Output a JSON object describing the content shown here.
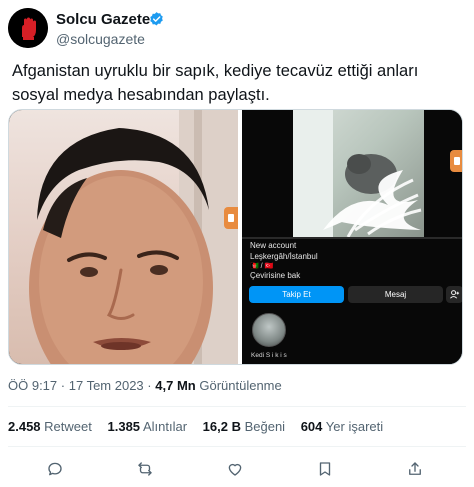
{
  "author": {
    "display_name": "Solcu Gazete",
    "handle": "@solcugazete",
    "verified": true,
    "avatar": "fist-logo-icon",
    "brand_color": "#d61f26"
  },
  "tweet": {
    "text": "Afganistan uyruklu bir sapık, kediye tecavüz ettiği anları sosyal medya hesabından paylaştı."
  },
  "media": {
    "instagram_profile": {
      "account_label": "New account",
      "location": "Leşkergâh/İstanbul",
      "flags": "🇦🇫 / 🇹🇷",
      "translate_label": "Çevirisine bak",
      "follow_label": "Takip Et",
      "message_label": "Mesaj",
      "add_user_icon": "add-user-icon",
      "highlight_label": "Kedi S i k i s"
    }
  },
  "meta": {
    "time": "ÖÖ 9:17",
    "separator": "·",
    "date": "17 Tem 2023",
    "views_count": "4,7 Mn",
    "views_label": "Görüntülenme"
  },
  "stats": {
    "retweets_count": "2.458",
    "retweets_label": "Retweet",
    "quotes_count": "1.385",
    "quotes_label": "Alıntılar",
    "likes_count": "16,2 B",
    "likes_label": "Beğeni",
    "bookmarks_count": "604",
    "bookmarks_label": "Yer işareti"
  },
  "actions": [
    "reply-icon",
    "retweet-icon",
    "like-icon",
    "bookmark-icon",
    "share-icon"
  ],
  "colors": {
    "text_primary": "#0f1419",
    "text_secondary": "#536471",
    "verified_blue": "#1d9bf0",
    "instagram_blue": "#0095f6"
  }
}
